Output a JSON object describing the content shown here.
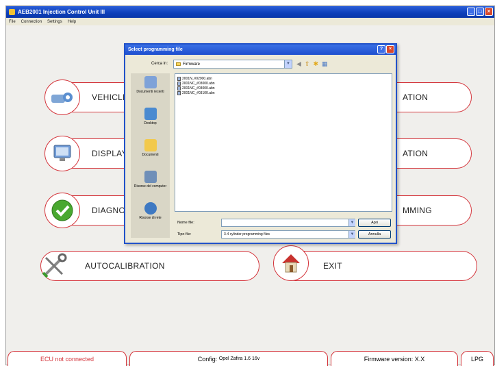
{
  "window": {
    "title": "AEB2001 Injection Control Unit III"
  },
  "menu": [
    "File",
    "Connection",
    "Settings",
    "Help"
  ],
  "buttons": {
    "vehicle": "VEHICLE",
    "display": "DISPLAY",
    "diagnostics": "DIAGNO",
    "vehicle_right": "ATION",
    "display_right": "ATION",
    "diagnostics_right": "MMING",
    "autocalibration": "AUTOCALIBRATION",
    "exit": "EXIT"
  },
  "status": {
    "ecu": "ECU not connected",
    "config_label": "Config:",
    "config_value": "Opel Zafira 1.6 16v",
    "firmware_label": "Firmware version:",
    "firmware_value": "X.X",
    "fuel": "LPG"
  },
  "dialog": {
    "title": "Select programming file",
    "lookin_label": "Cerca in:",
    "lookin_value": "Firmware",
    "places": [
      "Documenti recenti",
      "Desktop",
      "Documenti",
      "Risorse del computer",
      "Risorse di rete"
    ],
    "files": [
      "2001N_#02900.abn",
      "2001NC_#03000.abn",
      "2001NC_#03000.abn",
      "2001NC_#03100.abn"
    ],
    "filename_label": "Nome file:",
    "filename_value": "",
    "filetype_label": "Tipo file:",
    "filetype_value": "3-4 cylinder programming files",
    "open_button": "Apri",
    "cancel_button": "Annulla"
  },
  "colors": {
    "accent": "#d4333a",
    "title_bar": "#0d3fb9",
    "dialog_bg": "#ece9d8"
  }
}
